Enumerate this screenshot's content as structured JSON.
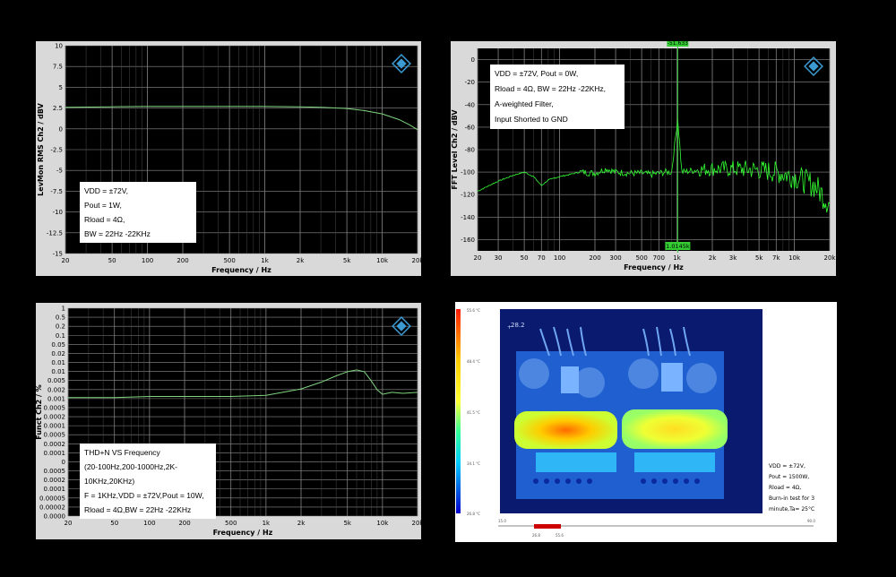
{
  "chart_data": [
    {
      "type": "line",
      "xlabel": "Frequency / Hz",
      "ylabel": "LevMon RMS Ch2 / dBV",
      "x_scale": "log",
      "xlim": [
        20,
        20000
      ],
      "ylim": [
        -15,
        10
      ],
      "x_ticks": [
        20,
        50,
        100,
        200,
        500,
        1000,
        2000,
        5000,
        10000,
        20000
      ],
      "x_tick_labels": [
        "20",
        "50",
        "100",
        "200",
        "500",
        "1k",
        "2k",
        "5k",
        "10k",
        "20k"
      ],
      "y_ticks": [
        10,
        7.5,
        5,
        2.5,
        0,
        -2.5,
        -5,
        -7.5,
        -10,
        -12.5,
        -15
      ],
      "y_tick_labels": [
        "10",
        "7.5",
        "5",
        "2.5",
        "0",
        "-2.5",
        "-5",
        "-7.5",
        "-10",
        "-12.5",
        "-15"
      ],
      "annotation": [
        "VDD = ±72V,",
        "Pout = 1W,",
        "Rload = 4Ω,",
        "BW = 22Hz -22KHz"
      ],
      "series": [
        {
          "x": [
            20,
            50,
            100,
            200,
            500,
            1000,
            2000,
            3000,
            5000,
            7000,
            10000,
            14000,
            17000,
            20000
          ],
          "values": [
            2.6,
            2.65,
            2.7,
            2.7,
            2.7,
            2.7,
            2.65,
            2.6,
            2.45,
            2.2,
            1.8,
            1.1,
            0.5,
            -0.1
          ]
        }
      ]
    },
    {
      "type": "line",
      "xlabel": "Frequency / Hz",
      "ylabel": "FFT Level Ch2 / dBV",
      "x_scale": "log",
      "xlim": [
        20,
        20000
      ],
      "ylim": [
        -170,
        10
      ],
      "x_ticks": [
        20,
        30,
        50,
        70,
        100,
        200,
        300,
        500,
        700,
        1000,
        2000,
        3000,
        5000,
        7000,
        10000,
        20000
      ],
      "x_tick_labels": [
        "20",
        "30",
        "50",
        "70",
        "100",
        "200",
        "300",
        "500",
        "700",
        "1k",
        "2k",
        "3k",
        "5k",
        "7k",
        "10k",
        "20k"
      ],
      "y_ticks": [
        0,
        -20,
        -40,
        -60,
        -80,
        -100,
        -120,
        -140,
        -160
      ],
      "y_tick_labels": [
        "0",
        "-20",
        "-40",
        "-60",
        "-80",
        "-100",
        "-120",
        "-140",
        "-160"
      ],
      "cursor_top": "-51.633",
      "cursor_bottom": "1.0145k",
      "cursor_x": 1014.5,
      "annotation": [
        "VDD = ±72V, Pout = 0W,",
        "Rload = 4Ω, BW = 22Hz -22KHz,",
        "A-weighted Filter,",
        "Input Shorted to GND"
      ],
      "series": [
        {
          "x": [
            20,
            30,
            40,
            50,
            60,
            70,
            80,
            100,
            150,
            200,
            250,
            300,
            400,
            500,
            600,
            700,
            800,
            900,
            1014.5,
            1100,
            1500,
            2000,
            3000,
            5000,
            7000,
            10000,
            15000,
            20000
          ],
          "values": [
            -117,
            -108,
            -103,
            -100,
            -104,
            -112,
            -107,
            -104,
            -100,
            -101,
            -97,
            -100,
            -101,
            -101,
            -102,
            -101,
            -100,
            -100,
            -52,
            -100,
            -98,
            -97,
            -97,
            -98,
            -100,
            -104,
            -112,
            -128
          ]
        }
      ]
    },
    {
      "type": "line",
      "xlabel": "Frequency / Hz",
      "ylabel": "Funct Ch2 / %",
      "x_scale": "log",
      "y_scale": "log",
      "xlim": [
        20,
        20000
      ],
      "ylim": [
        0.0001,
        1
      ],
      "x_ticks": [
        20,
        50,
        100,
        200,
        500,
        1000,
        2000,
        5000,
        10000,
        20000
      ],
      "x_tick_labels": [
        "20",
        "50",
        "100",
        "200",
        "500",
        "1k",
        "2k",
        "5k",
        "10k",
        "20k"
      ],
      "y_tick_labels": [
        "1",
        "0.5",
        "0.2",
        "0.1",
        "0.05",
        "0.02",
        "0.01",
        "0.01",
        "0.005",
        "0.002",
        "0.001",
        "0.0005",
        "0.0002",
        "0.0001",
        "0.0005",
        "0.0002",
        "0.0001",
        "0",
        "0.0005",
        "0.0002",
        "0.0001",
        "0.00005",
        "0.00002",
        "0.0000"
      ],
      "annotation": [
        "THD+N VS  Frequency",
        "(20-100Hz,200-1000Hz,2K-10KHz,20KHz)",
        "F = 1KHz,VDD = ±72V,Pout = 10W,",
        "Rload = 4Ω,BW = 22Hz -22KHz"
      ],
      "series": [
        {
          "x": [
            20,
            50,
            100,
            200,
            500,
            1000,
            2000,
            3000,
            4000,
            5000,
            6000,
            7000,
            8000,
            9000,
            10000,
            12000,
            15000,
            20000
          ],
          "values": [
            0.019,
            0.019,
            0.02,
            0.02,
            0.02,
            0.021,
            0.028,
            0.038,
            0.05,
            0.06,
            0.065,
            0.06,
            0.04,
            0.027,
            0.022,
            0.024,
            0.023,
            0.024
          ]
        }
      ]
    }
  ],
  "thermal": {
    "hotspot_label": "28.2",
    "scale_labels": [
      "55.6 °C",
      "48.4 °C",
      "41.5 °C",
      "34.1 °C",
      "26.8 °C"
    ],
    "slider_min": "15.0",
    "slider_max": "90.0",
    "slider_left": "26.8",
    "slider_right": "55.6",
    "notes": [
      "VDD = ±72V,",
      "Pout = 1500W,",
      "Rload = 4Ω,",
      "Burn-in test for 3",
      "minute,Ta= 25°C"
    ]
  },
  "colors": {
    "plot_bg": "#000000",
    "grid": "#8c8c8c",
    "trace": "#7fd47f",
    "fft_trace": "#33ff33",
    "cursor": "#33cc33",
    "panel_bg": "#d9d9d9",
    "logo": "#3c9ad2"
  },
  "logo_icon": "rs-diamond-logo-icon"
}
